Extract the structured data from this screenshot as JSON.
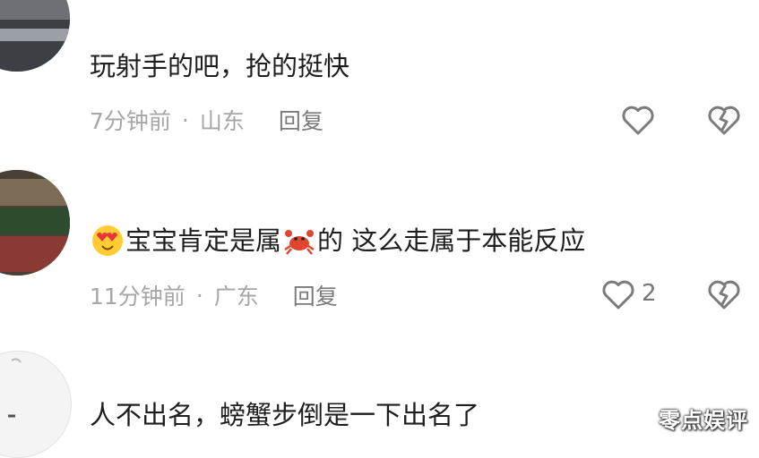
{
  "comments": [
    {
      "text": "玩射手的吧，抢的挺快",
      "time": "7分钟前",
      "location": "山东",
      "reply_label": "回复",
      "likes": ""
    },
    {
      "text_before_emoji": "宝宝肯定是属",
      "text_after_emoji": "的 这么走属于本能反应",
      "leading_emoji": "heart-eyes-emoji",
      "inline_emoji": "crab-emoji",
      "time": "11分钟前",
      "location": "广东",
      "reply_label": "回复",
      "likes": "2"
    },
    {
      "text": "人不出名，螃蟹步倒是一下出名了"
    }
  ],
  "separator": "·",
  "watermark": "零点娱评",
  "colors": {
    "text": "#1e1e1e",
    "meta": "#a6a6a6",
    "reply": "#7a7a7a",
    "icon": "#7b7b7b"
  }
}
